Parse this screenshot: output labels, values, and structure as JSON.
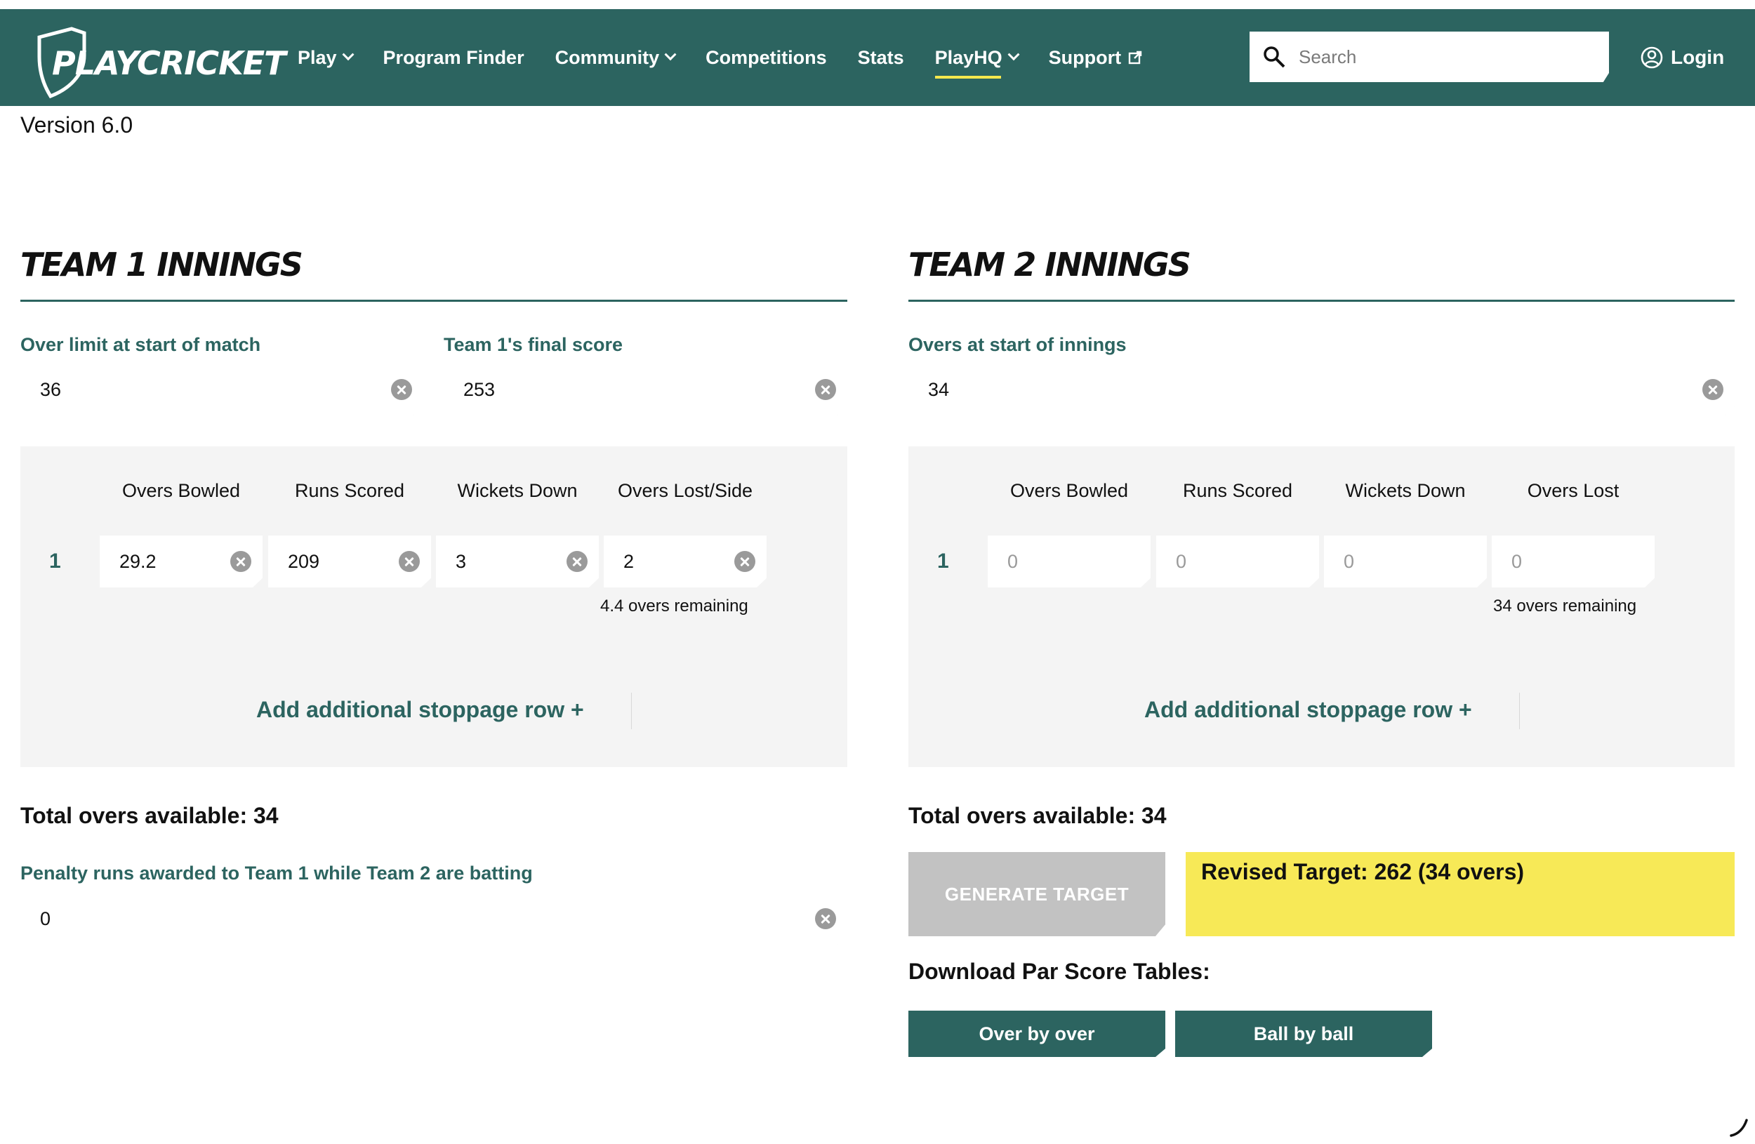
{
  "header": {
    "logo_text": "PLAYCRICKET",
    "nav": [
      {
        "label": "Play",
        "has_dropdown": true
      },
      {
        "label": "Program Finder"
      },
      {
        "label": "Community",
        "has_dropdown": true
      },
      {
        "label": "Competitions"
      },
      {
        "label": "Stats"
      },
      {
        "label": "PlayHQ",
        "has_dropdown": true,
        "active": true
      },
      {
        "label": "Support",
        "external": true
      }
    ],
    "search_placeholder": "Search",
    "login_label": "Login"
  },
  "version": "Version 6.0",
  "team1": {
    "title": "TEAM 1 INNINGS",
    "over_limit_label": "Over limit at start of match",
    "over_limit_value": "36",
    "final_score_label": "Team 1's final score",
    "final_score_value": "253",
    "columns": [
      "Overs Bowled",
      "Runs Scored",
      "Wickets Down",
      "Overs Lost/Side"
    ],
    "rows": [
      {
        "num": "1",
        "overs_bowled": "29.2",
        "runs_scored": "209",
        "wickets_down": "3",
        "overs_lost": "2",
        "remaining": "4.4 overs remaining"
      }
    ],
    "add_row_label": "Add additional stoppage row +",
    "total_overs": "Total overs available: 34",
    "penalty_label": "Penalty runs awarded to Team 1 while Team 2 are batting",
    "penalty_value": "0"
  },
  "team2": {
    "title": "TEAM 2 INNINGS",
    "overs_start_label": "Overs at start of innings",
    "overs_start_value": "34",
    "columns": [
      "Overs Bowled",
      "Runs Scored",
      "Wickets Down",
      "Overs Lost"
    ],
    "rows": [
      {
        "num": "1",
        "overs_bowled": "0",
        "runs_scored": "0",
        "wickets_down": "0",
        "overs_lost": "0",
        "remaining": "34 overs remaining"
      }
    ],
    "add_row_label": "Add additional stoppage row +",
    "total_overs": "Total overs available: 34",
    "generate_label": "GENERATE TARGET",
    "revised_target": "Revised Target: 262 (34 overs)",
    "download_label": "Download Par Score Tables:",
    "download_buttons": [
      "Over by over",
      "Ball by ball"
    ]
  },
  "colors": {
    "brand_green": "#2c6460",
    "highlight_yellow": "#f7e957",
    "panel_grey": "#f4f4f4",
    "disabled_grey": "#c2c2c2"
  }
}
